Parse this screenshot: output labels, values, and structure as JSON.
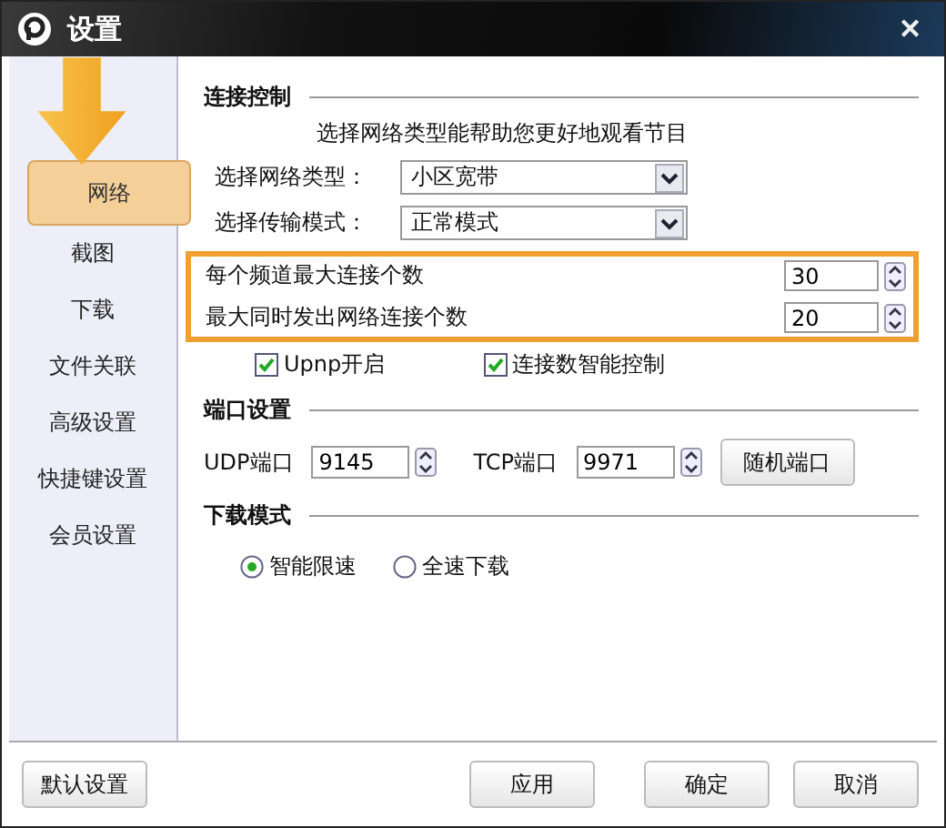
{
  "window": {
    "title": "设置",
    "close": "✕"
  },
  "sidebar": {
    "items": [
      {
        "label": "网络",
        "selected": true
      },
      {
        "label": "截图",
        "selected": false
      },
      {
        "label": "下载",
        "selected": false
      },
      {
        "label": "文件关联",
        "selected": false
      },
      {
        "label": "高级设置",
        "selected": false
      },
      {
        "label": "快捷键设置",
        "selected": false
      },
      {
        "label": "会员设置",
        "selected": false
      }
    ]
  },
  "connection": {
    "heading": "连接控制",
    "hint": "选择网络类型能帮助您更好地观看节目",
    "selects": [
      {
        "label": "选择网络类型：",
        "value": "小区宽带"
      },
      {
        "label": "选择传输模式：",
        "value": "正常模式"
      }
    ],
    "spinners": [
      {
        "label": "每个频道最大连接个数",
        "value": "30"
      },
      {
        "label": "最大同时发出网络连接个数",
        "value": "20"
      }
    ],
    "checkboxes": [
      {
        "label": "Upnp开启",
        "checked": true
      },
      {
        "label": "连接数智能控制",
        "checked": true
      }
    ]
  },
  "ports": {
    "heading": "端口设置",
    "fields": [
      {
        "label": "UDP端口",
        "value": "9145"
      },
      {
        "label": "TCP端口",
        "value": "9971"
      }
    ],
    "button": "随机端口"
  },
  "download_mode": {
    "heading": "下载模式",
    "options": [
      {
        "label": "智能限速",
        "selected": true
      },
      {
        "label": "全速下载",
        "selected": false
      }
    ]
  },
  "footer": {
    "left": "默认设置",
    "buttons": [
      "应用",
      "确定",
      "取消"
    ]
  }
}
